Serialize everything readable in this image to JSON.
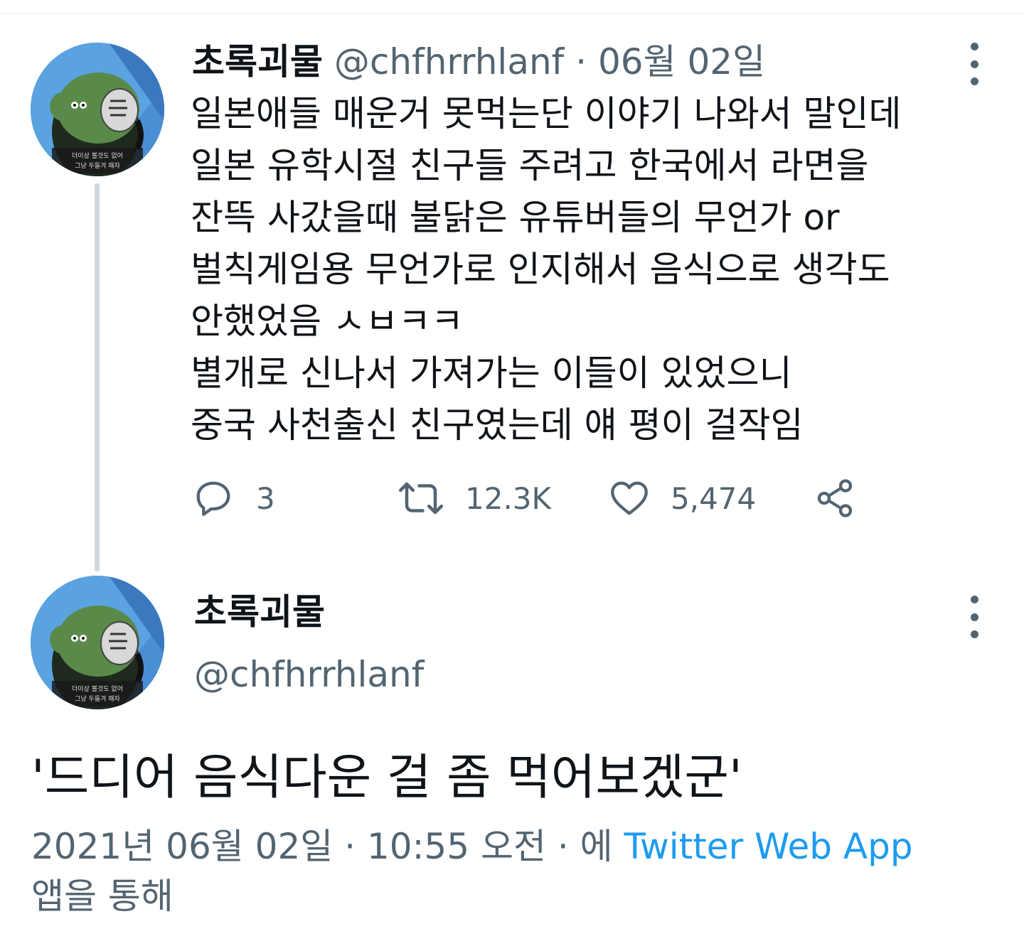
{
  "colors": {
    "text_primary": "#0f1419",
    "text_secondary": "#536471",
    "link": "#1d9bf0",
    "thread_line": "#cfd9de"
  },
  "tweet1": {
    "display_name": "초록괴물",
    "handle": "@chfhrrhlanf",
    "separator": "·",
    "date": "06월 02일",
    "more_icon": "more-vertical-icon",
    "body_lines": [
      "일본애들 매운거 못먹는단 이야기 나와서 말인데",
      "일본 유학시절 친구들 주려고 한국에서 라면을",
      "잔뜩 사갔을때 불닭은 유튜버들의 무언가 or",
      "벌칙게임용 무언가로 인지해서 음식으로 생각도",
      "안했었음 ㅅㅂㅋㅋ",
      "별개로 신나서 가져가는 이들이 있었으니",
      "중국 사천출신 친구였는데 얘 평이 걸작임"
    ],
    "actions": {
      "reply": {
        "icon": "reply-icon",
        "count": "3"
      },
      "retweet": {
        "icon": "retweet-icon",
        "count": "12.3K"
      },
      "like": {
        "icon": "heart-icon",
        "count": "5,474"
      },
      "share": {
        "icon": "share-icon"
      }
    },
    "avatar_caption_lines": [
      "더이상 볼것도 없어",
      "그냥 두들겨 패자"
    ]
  },
  "tweet2": {
    "display_name": "초록괴물",
    "handle": "@chfhrrhlanf",
    "more_icon": "more-vertical-icon",
    "body": "'드디어 음식다운 걸 좀 먹어보겠군'",
    "meta": {
      "timestamp": "2021년 06월 02일 · 10:55 오전 · 에",
      "source": "Twitter Web App",
      "suffix": "앱을 통해"
    },
    "avatar_caption_lines": [
      "더이상 볼것도 없어",
      "그냥 두들겨 패자"
    ]
  }
}
